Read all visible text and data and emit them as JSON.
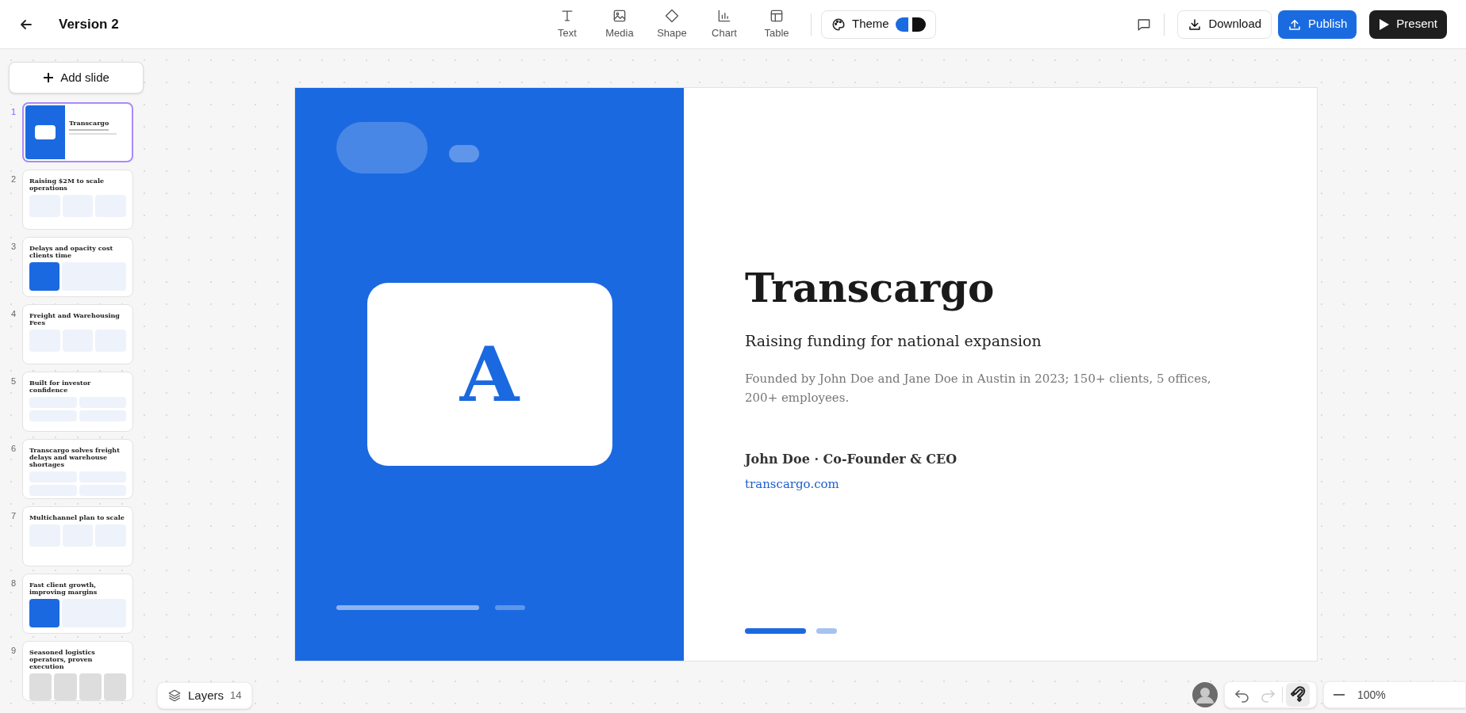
{
  "header": {
    "title": "Version 2"
  },
  "toolbar": [
    {
      "kind": "text",
      "label": "Text"
    },
    {
      "kind": "media",
      "label": "Media"
    },
    {
      "kind": "shape",
      "label": "Shape"
    },
    {
      "kind": "chart",
      "label": "Chart"
    },
    {
      "kind": "table",
      "label": "Table"
    }
  ],
  "theme": {
    "label": "Theme"
  },
  "actions": [
    {
      "kind": "download",
      "label": "Download"
    },
    {
      "kind": "publish",
      "label": "Publish"
    },
    {
      "kind": "present",
      "label": "Present"
    }
  ],
  "sidebar": {
    "add_label": "Add slide",
    "slides": [
      {
        "number": "1",
        "kind": "cover",
        "title": "Transcargo",
        "selected": true
      },
      {
        "number": "2",
        "kind": "cards",
        "title": "Raising $2M to scale operations",
        "selected": false
      },
      {
        "number": "3",
        "kind": "split",
        "title": "Delays and opacity cost clients time",
        "selected": false
      },
      {
        "number": "4",
        "kind": "cards",
        "title": "Freight and Warehousing Fees",
        "selected": false
      },
      {
        "number": "5",
        "kind": "list",
        "title": "Built for investor confidence",
        "selected": false
      },
      {
        "number": "6",
        "kind": "list",
        "title": "Transcargo solves freight delays and warehouse shortages",
        "selected": false
      },
      {
        "number": "7",
        "kind": "cards",
        "title": "Multichannel plan to scale",
        "selected": false
      },
      {
        "number": "8",
        "kind": "split",
        "title": "Fast client growth, improving margins",
        "selected": false
      },
      {
        "number": "9",
        "kind": "people",
        "title": "Seasoned logistics operators, proven execution",
        "selected": false
      }
    ]
  },
  "slide": {
    "logo_letter": "A",
    "title": "Transcargo",
    "subtitle": "Raising funding for national expansion",
    "description": "Founded by John Doe and Jane Doe in Austin in 2023; 150+ clients, 5 offices, 200+ employees.",
    "author": "John Doe · Co-Founder & CEO",
    "link": "transcargo.com"
  },
  "layers": {
    "label": "Layers",
    "count": "14"
  },
  "zoom": {
    "value": "100%"
  }
}
